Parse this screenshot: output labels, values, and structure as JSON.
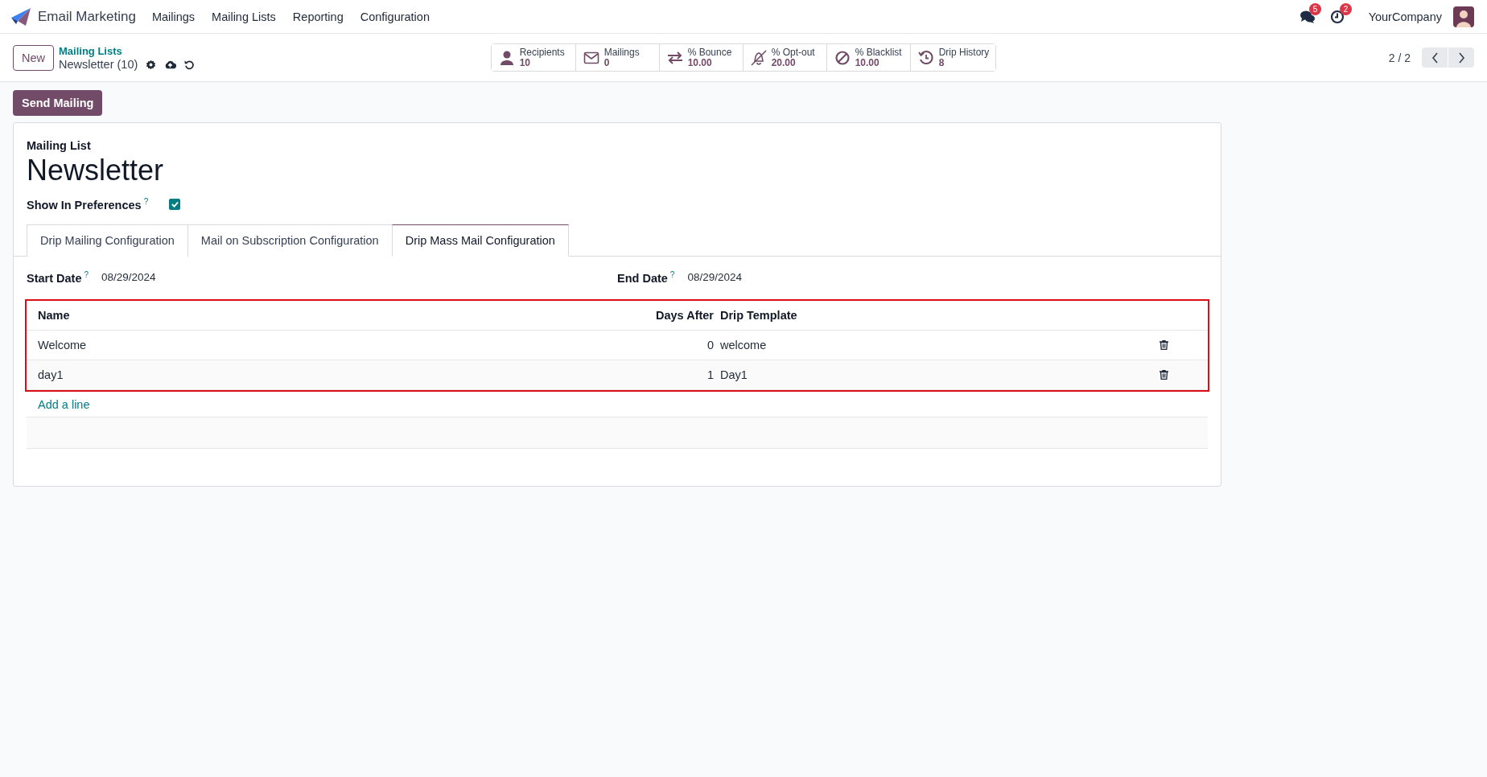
{
  "navbar": {
    "app_name": "Email Marketing",
    "menu": [
      "Mailings",
      "Mailing Lists",
      "Reporting",
      "Configuration"
    ],
    "messages_count": "5",
    "activities_count": "2",
    "company": "YourCompany"
  },
  "control_panel": {
    "new_button": "New",
    "breadcrumb": "Mailing Lists",
    "record": "Newsletter (10)",
    "pager": "2 / 2",
    "stat_buttons": [
      {
        "label": "Recipients",
        "value": "10"
      },
      {
        "label": "Mailings",
        "value": "0"
      },
      {
        "label": "% Bounce",
        "value": "10.00"
      },
      {
        "label": "% Opt-out",
        "value": "20.00"
      },
      {
        "label": "% Blacklist",
        "value": "10.00"
      },
      {
        "label": "Drip History",
        "value": "8"
      }
    ]
  },
  "action_button": "Send Mailing",
  "form": {
    "caption": "Mailing List",
    "title": "Newsletter",
    "preference": {
      "label": "Show In Preferences",
      "help": "?",
      "checked": true
    },
    "tabs": [
      {
        "label": "Drip Mailing Configuration",
        "selected": false
      },
      {
        "label": "Mail on Subscription Configuration",
        "selected": false
      },
      {
        "label": "Drip Mass Mail Configuration",
        "selected": true
      }
    ],
    "fields": [
      {
        "label": "Start Date",
        "help": "?",
        "value": "08/29/2024"
      },
      {
        "label": "End Date",
        "help": "?",
        "value": "08/29/2024"
      }
    ],
    "table": {
      "highlighted": true,
      "columns": [
        "Name",
        "Days After",
        "Drip Template"
      ],
      "rows": [
        {
          "name": "Welcome",
          "days_after": "0",
          "drip_template": "welcome"
        },
        {
          "name": "day1",
          "days_after": "1",
          "drip_template": "Day1"
        }
      ],
      "add_line": "Add a line"
    }
  }
}
